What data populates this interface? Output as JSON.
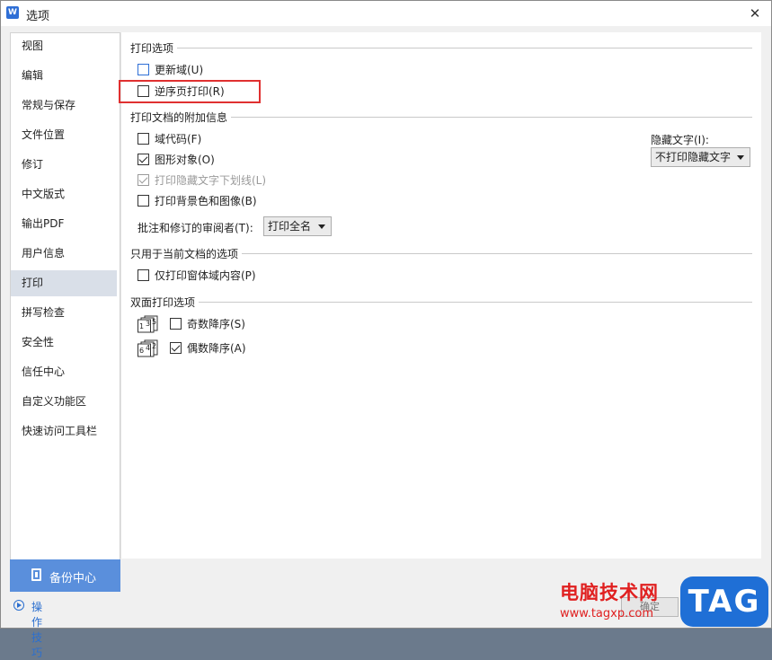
{
  "window": {
    "title": "选项",
    "app_icon_glyph": "W"
  },
  "sidebar": {
    "items": [
      {
        "label": "视图"
      },
      {
        "label": "编辑"
      },
      {
        "label": "常规与保存"
      },
      {
        "label": "文件位置"
      },
      {
        "label": "修订"
      },
      {
        "label": "中文版式"
      },
      {
        "label": "输出PDF"
      },
      {
        "label": "用户信息"
      },
      {
        "label": "打印",
        "selected": true
      },
      {
        "label": "拼写检查"
      },
      {
        "label": "安全性"
      },
      {
        "label": "信任中心"
      },
      {
        "label": "自定义功能区"
      },
      {
        "label": "快速访问工具栏"
      }
    ],
    "backup_label": "备份中心",
    "tips_label": "操作技巧"
  },
  "print_options": {
    "heading": "打印选项",
    "update_fields": {
      "label": "更新域(U)",
      "checked": false
    },
    "reverse_order": {
      "label": "逆序页打印(R)",
      "checked": false
    }
  },
  "extra_info": {
    "heading": "打印文档的附加信息",
    "field_codes": {
      "label": "域代码(F)",
      "checked": false
    },
    "drawing_objects": {
      "label": "图形对象(O)",
      "checked": true
    },
    "hidden_text_underline": {
      "label": "打印隐藏文字下划线(L)",
      "checked": true,
      "disabled": true
    },
    "background": {
      "label": "打印背景色和图像(B)",
      "checked": false
    },
    "reviewer_label": "批注和修订的审阅者(T):",
    "reviewer_value": "打印全名",
    "hidden_text_label": "隐藏文字(I):",
    "hidden_text_value": "不打印隐藏文字"
  },
  "current_doc": {
    "heading": "只用于当前文档的选项",
    "form_data_only": {
      "label": "仅打印窗体域内容(P)",
      "checked": false
    }
  },
  "duplex": {
    "heading": "双面打印选项",
    "odd_reverse": {
      "label": "奇数降序(S)",
      "checked": false,
      "icon_text": "135"
    },
    "even_reverse": {
      "label": "偶数降序(A)",
      "checked": true,
      "icon_text": "642"
    }
  },
  "footer": {
    "ok_label": "确定"
  },
  "watermark": {
    "title": "电脑技术网",
    "url": "www.tagxp.com",
    "tag": "TAG"
  },
  "colors": {
    "accent": "#5a8fdc",
    "highlight": "#e03030",
    "selected_nav": "#d9dfe8"
  }
}
